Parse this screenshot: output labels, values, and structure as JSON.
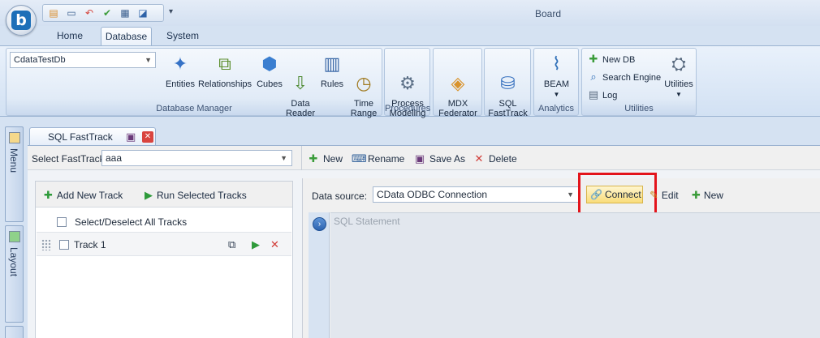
{
  "window": {
    "title": "Board"
  },
  "quick_access": {
    "icons": [
      "layout-icon",
      "window-icon",
      "undo-icon",
      "check-icon",
      "grid-icon",
      "chart-icon"
    ]
  },
  "tabs": [
    {
      "label": "Home",
      "active": false
    },
    {
      "label": "Database",
      "active": true
    },
    {
      "label": "System",
      "active": false
    }
  ],
  "ribbon": {
    "database_manager": {
      "database_selector": "CdataTestDb",
      "buttons": [
        {
          "label": "Entities",
          "icon": "entities-icon"
        },
        {
          "label": "Relationships",
          "icon": "relationships-icon"
        },
        {
          "label": "Cubes",
          "icon": "cubes-icon"
        },
        {
          "label": "Data\nReader",
          "icon": "data-reader-icon"
        },
        {
          "label": "Rules",
          "icon": "rules-icon"
        },
        {
          "label": "Time\nRange",
          "icon": "time-range-icon"
        }
      ],
      "label": "Database Manager"
    },
    "procedures": {
      "button": "Process\nModeling",
      "label": "Procedures"
    },
    "mdx": {
      "button": "MDX\nFederator"
    },
    "sql": {
      "button": "SQL\nFastTrack"
    },
    "analytics": {
      "button": "BEAM",
      "label": "Analytics"
    },
    "utilities": {
      "new_db": "New DB",
      "search_engine": "Search Engine",
      "log": "Log",
      "utilities_button": "Utilities",
      "label": "Utilities"
    }
  },
  "sidebar": {
    "menu": "Menu",
    "layout": "Layout"
  },
  "document_tab": {
    "label": "SQL FastTrack"
  },
  "toolbar": {
    "select_label": "Select FastTrack",
    "select_value": "aaa",
    "new": "New",
    "rename": "Rename",
    "save_as": "Save As",
    "delete": "Delete"
  },
  "tracks_panel": {
    "add_track": "Add New Track",
    "run_selected": "Run Selected Tracks",
    "select_all": "Select/Deselect All Tracks",
    "tracks": [
      {
        "name": "Track 1"
      }
    ]
  },
  "datasource": {
    "label": "Data source:",
    "value": "CData ODBC Connection",
    "connect": "Connect",
    "edit": "Edit",
    "new": "New",
    "sql_placeholder": "SQL Statement"
  },
  "colors": {
    "highlight": "#e3141b",
    "accent": "#1d6fb8"
  }
}
